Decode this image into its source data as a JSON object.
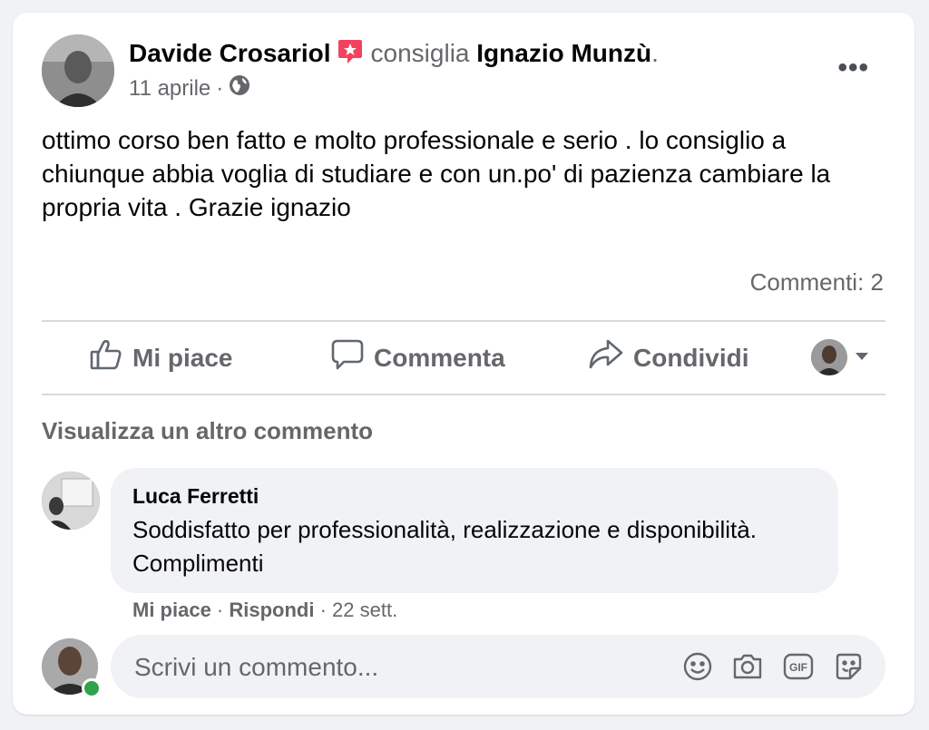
{
  "post": {
    "author_name": "Davide Crosariol",
    "verb": "consiglia",
    "page_name": "Ignazio Munzù",
    "page_suffix": ".",
    "date": "11 aprile",
    "separator": "·",
    "audience_icon": "globe-icon",
    "more_label": "•••",
    "text": "ottimo corso ben fatto e molto professionale e serio . lo consiglio a chiunque abbia voglia di studiare e con un.po' di pazienza cambiare la propria vita . Grazie ignazio",
    "comments_count": "Commenti: 2"
  },
  "actions": {
    "like": "Mi piace",
    "comment": "Commenta",
    "share": "Condividi"
  },
  "comments": {
    "view_more": "Visualizza un altro commento",
    "items": [
      {
        "author": "Luca Ferretti",
        "text": "Soddisfatto per professionalità, realizzazione e disponibilità. Complimenti",
        "like": "Mi piace",
        "reply": "Rispondi",
        "time": "22 sett.",
        "sep": " · "
      }
    ]
  },
  "composer": {
    "placeholder": "Scrivi un commento...",
    "icons": [
      "smiley-icon",
      "camera-icon",
      "gif-icon",
      "sticker-icon"
    ]
  },
  "colors": {
    "background": "#f0f2f5",
    "card": "#ffffff",
    "muted_text": "#65676b",
    "recommend_badge": "#f3425f",
    "online": "#31a24c"
  }
}
